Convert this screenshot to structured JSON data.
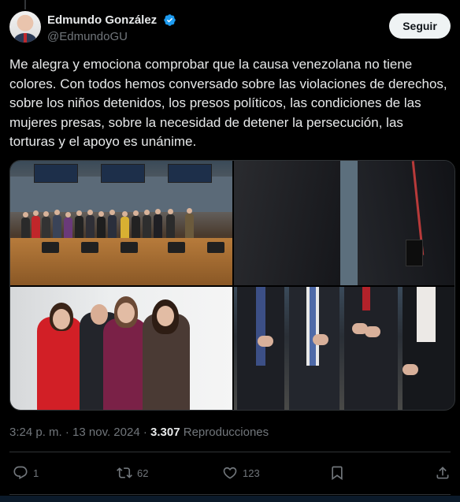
{
  "author": {
    "display_name": "Edmundo González",
    "handle": "@EdmundoGU",
    "verified": true,
    "verified_color": "#1d9bf0"
  },
  "follow_button": {
    "label": "Seguir"
  },
  "tweet": {
    "text": "Me alegra y emociona comprobar que la causa venezolana no tiene colores. Con todos hemos conversado sobre las violaciones de derechos, sobre los niños detenidos, los presos políticos, las condiciones de las mujeres presas, sobre la necesidad de detener la persecución, las torturas y el apoyo es unánime."
  },
  "media": {
    "count": 4
  },
  "meta": {
    "time": "3:24 p. m.",
    "separator": "·",
    "date": "13 nov. 2024",
    "separator2": "·",
    "views_count": "3.307",
    "views_label": "Reproducciones"
  },
  "actions": {
    "replies": "1",
    "retweets": "62",
    "likes": "123"
  },
  "icons": {
    "reply": "reply-icon",
    "retweet": "retweet-icon",
    "like": "heart-icon",
    "bookmark": "bookmark-icon",
    "share": "share-icon"
  },
  "colors": {
    "background": "#000000",
    "text": "#e7e9ea",
    "muted": "#71767b",
    "follow_bg": "#eff3f4"
  }
}
